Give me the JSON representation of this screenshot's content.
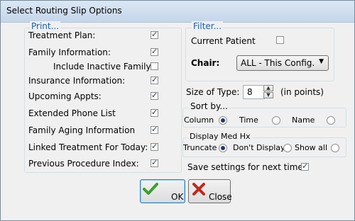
{
  "window": {
    "title": "Select Routing Slip Options"
  },
  "print": {
    "legend": "Print...",
    "items": [
      {
        "label": "Treatment Plan:",
        "checked": true
      },
      {
        "label": "Family Information:",
        "checked": true
      },
      {
        "label": "Include Inactive Family",
        "checked": false
      },
      {
        "label": "Insurance Information:",
        "checked": true
      },
      {
        "label": "Upcoming Appts:",
        "checked": true
      },
      {
        "label": "Extended Phone List",
        "checked": true
      },
      {
        "label": "Family Aging Information",
        "checked": true
      },
      {
        "label": "Linked Treatment For Today:",
        "checked": true
      },
      {
        "label": "Previous Procedure Index:",
        "checked": true
      }
    ]
  },
  "filter": {
    "legend": "Filter...",
    "current_patient_label": "Current Patient",
    "current_patient_checked": false,
    "chair_label": "Chair:",
    "chair_value": "ALL - This Config."
  },
  "size": {
    "label": "Size of Type:",
    "value": "8",
    "unit": "(in points)"
  },
  "sort": {
    "legend": "Sort by...",
    "options": [
      {
        "label": "Column",
        "selected": true
      },
      {
        "label": "Time",
        "selected": false
      },
      {
        "label": "Name",
        "selected": false
      }
    ]
  },
  "medhx": {
    "legend": "Display Med Hx",
    "options": [
      {
        "label": "Truncate",
        "selected": true
      },
      {
        "label": "Don't Display",
        "selected": false
      },
      {
        "label": "Show all",
        "selected": false
      }
    ]
  },
  "save": {
    "label": "Save settings for next time",
    "checked": true
  },
  "buttons": {
    "ok": "OK",
    "close": "Close"
  },
  "icons": {
    "check": "✓",
    "ok": "check-icon",
    "close": "x-icon"
  },
  "colors": {
    "legend_blue": "#1a5fb4",
    "ok_green": "#3aa02c",
    "close_red": "#c0281c"
  }
}
